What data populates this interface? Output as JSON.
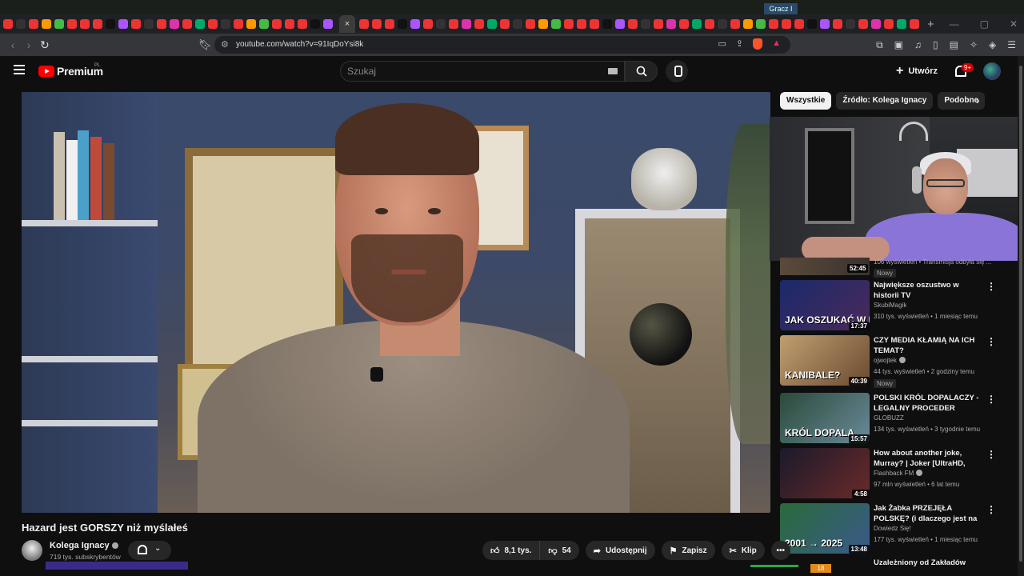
{
  "browser": {
    "overlay_label": "Gracz I",
    "url": "youtube.com/watch?v=91IqDoYsi8k",
    "tab_close": "×",
    "new_tab": "+"
  },
  "header": {
    "brand": "Premium",
    "country": "PL",
    "search_placeholder": "Szukaj",
    "create_label": "Utwórz",
    "notifications_badge": "9+"
  },
  "chips": [
    "Wszystkie",
    "Źródło: Kolega Ignacy",
    "Podobne"
  ],
  "partial_item": {
    "duration": "52:45",
    "meta": "106 wyświetleń • Transmisja odbyła się ...",
    "badge": "Nowy"
  },
  "recommendations": [
    {
      "title": "Największe oszustwo w historii TV",
      "channel": "SkubiMagik",
      "views": "310 tys. wyświetleń • 1 miesiąc temu",
      "duration": "17:37",
      "thumb_text": "JAK OSZUKAĆ W MILIONERACH",
      "verified": false,
      "badge": "",
      "color1": "#1a2a6a",
      "color2": "#4a2a5a"
    },
    {
      "title": "CZY MEDIA KŁAMIĄ NA ICH TEMAT?",
      "channel": "ojwojtek",
      "views": "44 tys. wyświetleń • 2 godziny temu",
      "duration": "40:39",
      "thumb_text": "KANIBALE?",
      "verified": true,
      "badge": "Nowy",
      "color1": "#c0a070",
      "color2": "#6a4a30"
    },
    {
      "title": "POLSKI KRÓL DOPALACZY - LEGALNY PROCEDER",
      "channel": "GLOBUZZ",
      "views": "134 tys. wyświetleń • 3 tygodnie temu",
      "duration": "15:57",
      "thumb_text": "KRÓL DOPALA",
      "verified": false,
      "badge": "",
      "color1": "#2a4a3a",
      "color2": "#6a8a9a"
    },
    {
      "title": "How about another joke, Murray? | Joker [UltraHD, HDR]",
      "channel": "Flashback FM",
      "views": "97 mln wyświetleń • 6 lat temu",
      "duration": "4:58",
      "thumb_text": "",
      "verified": true,
      "badge": "",
      "color1": "#1a1a2a",
      "color2": "#6a2a2a"
    },
    {
      "title": "Jak Żabka PRZEJĘŁA POLSKĘ? (i dlaczego jest na każdym ...",
      "channel": "Dowiedz Się!",
      "views": "177 tys. wyświetleń • 1 miesiąc temu",
      "duration": "13:48",
      "thumb_text": "2001 → 2025",
      "verified": false,
      "badge": "",
      "color1": "#2a6a3a",
      "color2": "#3a5a8a"
    }
  ],
  "cutoff_title": "Uzależniony od Zakładów",
  "video": {
    "title": "Hazard jest GORSZY niż myślałeś",
    "channel": "Kolega Ignacy",
    "subscribers": "719 tys. subskrybentów",
    "likes": "8,1 tys.",
    "dislikes": "54",
    "share": "Udostępnij",
    "save": "Zapisz",
    "clip": "Klip"
  },
  "bottom_badge": "18"
}
